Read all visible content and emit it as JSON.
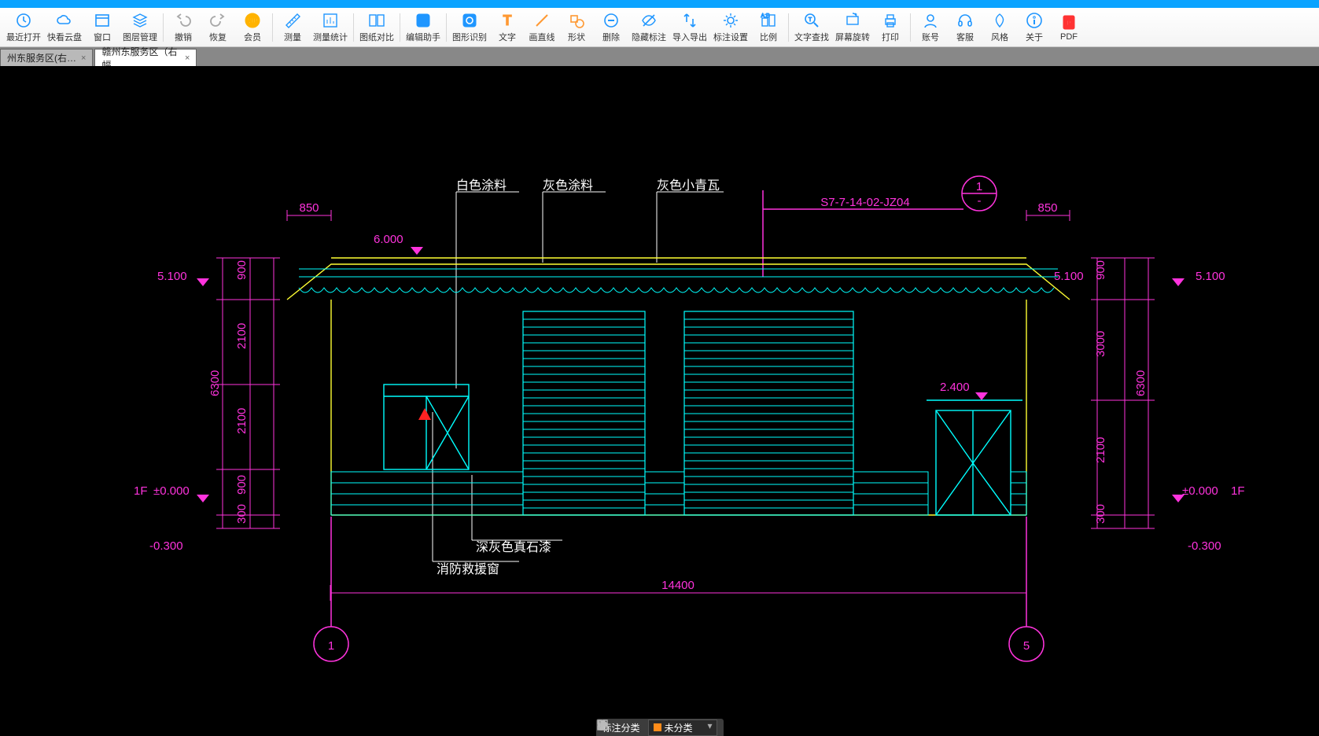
{
  "toolbar": [
    {
      "id": "recent",
      "label": "最近打开",
      "stroke": "#1f96ff"
    },
    {
      "id": "cloud",
      "label": "快看云盘",
      "stroke": "#1f96ff"
    },
    {
      "id": "window",
      "label": "窗口",
      "stroke": "#1f96ff"
    },
    {
      "id": "layers",
      "label": "图层管理",
      "stroke": "#1f96ff",
      "sep": true
    },
    {
      "id": "undo",
      "label": "撤销",
      "stroke": "#a8a8a8"
    },
    {
      "id": "redo",
      "label": "恢复",
      "stroke": "#a8a8a8"
    },
    {
      "id": "vip",
      "label": "会员",
      "stroke": "#ffb300",
      "sep": true
    },
    {
      "id": "measure",
      "label": "测量",
      "stroke": "#1f96ff"
    },
    {
      "id": "measure-stat",
      "label": "测量统计",
      "stroke": "#1f96ff",
      "sep": true
    },
    {
      "id": "compare",
      "label": "图纸对比",
      "stroke": "#1f96ff",
      "sep": true
    },
    {
      "id": "edit-assist",
      "label": "编辑助手",
      "stroke": "#1f96ff",
      "sep": true
    },
    {
      "id": "img-recog",
      "label": "图形识别",
      "stroke": "#1f96ff"
    },
    {
      "id": "text",
      "label": "文字",
      "stroke": "#ff9933"
    },
    {
      "id": "line",
      "label": "画直线",
      "stroke": "#ff9933"
    },
    {
      "id": "shape",
      "label": "形状",
      "stroke": "#ff9933"
    },
    {
      "id": "delete",
      "label": "删除",
      "stroke": "#1f96ff"
    },
    {
      "id": "hide-annot",
      "label": "隐藏标注",
      "stroke": "#1f96ff"
    },
    {
      "id": "import-export",
      "label": "导入导出",
      "stroke": "#1f96ff"
    },
    {
      "id": "annot-set",
      "label": "标注设置",
      "stroke": "#1f96ff"
    },
    {
      "id": "scale",
      "label": "比例",
      "stroke": "#1f96ff",
      "sep": true
    },
    {
      "id": "text-find",
      "label": "文字查找",
      "stroke": "#1f96ff"
    },
    {
      "id": "rotate",
      "label": "屏幕旋转",
      "stroke": "#1f96ff"
    },
    {
      "id": "print",
      "label": "打印",
      "stroke": "#1f96ff",
      "sep": true
    },
    {
      "id": "account",
      "label": "账号",
      "stroke": "#1f96ff"
    },
    {
      "id": "service",
      "label": "客服",
      "stroke": "#1f96ff"
    },
    {
      "id": "style",
      "label": "风格",
      "stroke": "#1f96ff"
    },
    {
      "id": "about",
      "label": "关于",
      "stroke": "#1f96ff"
    },
    {
      "id": "pdf",
      "label": "PDF",
      "stroke": "#ff3333"
    }
  ],
  "tabs": [
    {
      "label": "州东服务区(右…",
      "active": false
    },
    {
      "label": "赣州东服务区（右幅…",
      "active": true
    }
  ],
  "drawing": {
    "labels": {
      "white_paint": "白色涂料",
      "grey_paint": "灰色涂料",
      "grey_tile": "灰色小青瓦",
      "ref_code": "S7-7-14-02-JZ04",
      "dark_stone": "深灰色真石漆",
      "fire_window": "消防救援窗",
      "lvl_6000": "6.000",
      "lvl_5100": "5.100",
      "lvl_2400": "2.400",
      "lvl_0": "±0.000",
      "lvl_neg03": "-0.300",
      "storey": "1F",
      "axis1": "1",
      "axis5": "5",
      "detail1": "1",
      "detail_dash": "-"
    },
    "dims": {
      "d850": "850",
      "d900": "900",
      "d2100": "2100",
      "d6300": "6300",
      "d300": "300",
      "d14400": "14400",
      "d3000": "3000"
    }
  },
  "bottombar": {
    "annot_cat": "标注分类",
    "uncat": "未分类"
  }
}
